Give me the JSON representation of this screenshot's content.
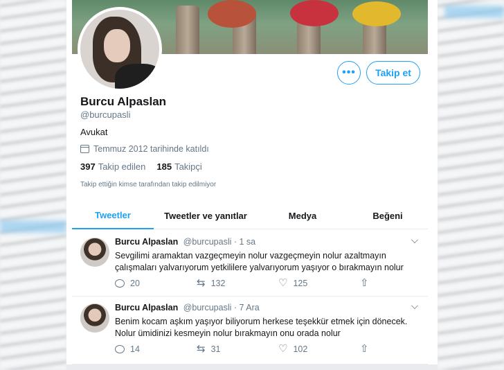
{
  "profile": {
    "name": "Burcu Alpaslan",
    "handle": "@burcupasli",
    "bio": "Avukat",
    "joined": "Temmuz 2012 tarihinde katıldı",
    "following_count": "397",
    "following_label": "Takip edilen",
    "followers_count": "185",
    "followers_label": "Takipçi",
    "not_followed_note": "Takip ettiğin kimse tarafından takip edilmiyor"
  },
  "buttons": {
    "more": "•••",
    "follow": "Takip et"
  },
  "tabs": [
    {
      "label": "Tweetler",
      "active": true
    },
    {
      "label": "Tweetler ve yanıtlar",
      "active": false
    },
    {
      "label": "Medya",
      "active": false
    },
    {
      "label": "Beğeni",
      "active": false
    }
  ],
  "tweets": [
    {
      "name": "Burcu Alpaslan",
      "meta": "@burcupasli · 1 sa",
      "text": "Sevgilimi aramaktan vazgeçmeyin nolur vazgeçmeyin nolur azaltmayın çalışmaları yalvarıyorum yetkililere yalvarıyorum yaşıyor o bırakmayın nolur",
      "replies": "20",
      "retweets": "132",
      "likes": "125"
    },
    {
      "name": "Burcu Alpaslan",
      "meta": "@burcupasli · 7 Ara",
      "text": "Benim kocam aşkım yaşıyor biliyorum herkese teşekkür etmek için dönecek. Nolur ümidinizi kesmeyin nolur bırakmayın onu orada nolur",
      "replies": "14",
      "retweets": "31",
      "likes": "102"
    }
  ],
  "colors": {
    "accent": "#1da1f2",
    "secondary_text": "#657786"
  },
  "icons": [
    "calendar-icon",
    "reply-icon",
    "retweet-icon",
    "like-icon",
    "share-icon",
    "chevron-down-icon"
  ]
}
